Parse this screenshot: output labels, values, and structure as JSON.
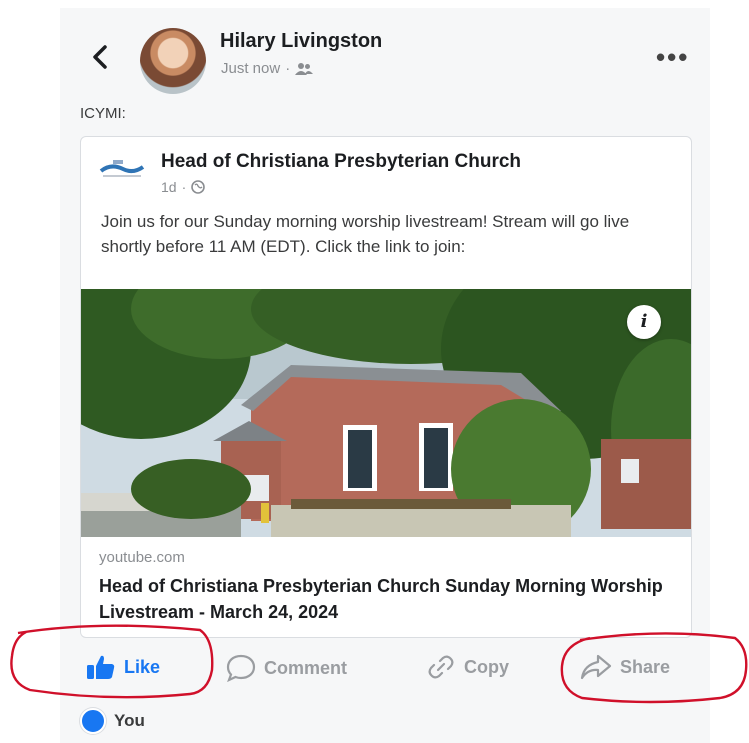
{
  "post": {
    "author": "Hilary Livingston",
    "time": "Just now",
    "separator": "·",
    "audience_icon": "friends-icon",
    "more_label": "•••",
    "text": "ICYMI:"
  },
  "shared": {
    "page_name": "Head of Christiana Presbyterian Church",
    "time": "1d",
    "separator": "·",
    "privacy_icon": "globe-icon",
    "text": "Join us for our Sunday morning worship livestream! Stream will go live shortly before 11 AM (EDT). Click the link to join:",
    "info_label": "i",
    "link": {
      "domain": "youtube.com",
      "title": "Head of Christiana Presbyterian Church Sunday Morning Worship Livestream - March 24, 2024"
    }
  },
  "actions": {
    "like": "Like",
    "comment": "Comment",
    "copy": "Copy",
    "share": "Share"
  },
  "reactions": {
    "label": "You"
  },
  "colors": {
    "accent": "#1877f2",
    "annotation": "#d0102a"
  }
}
